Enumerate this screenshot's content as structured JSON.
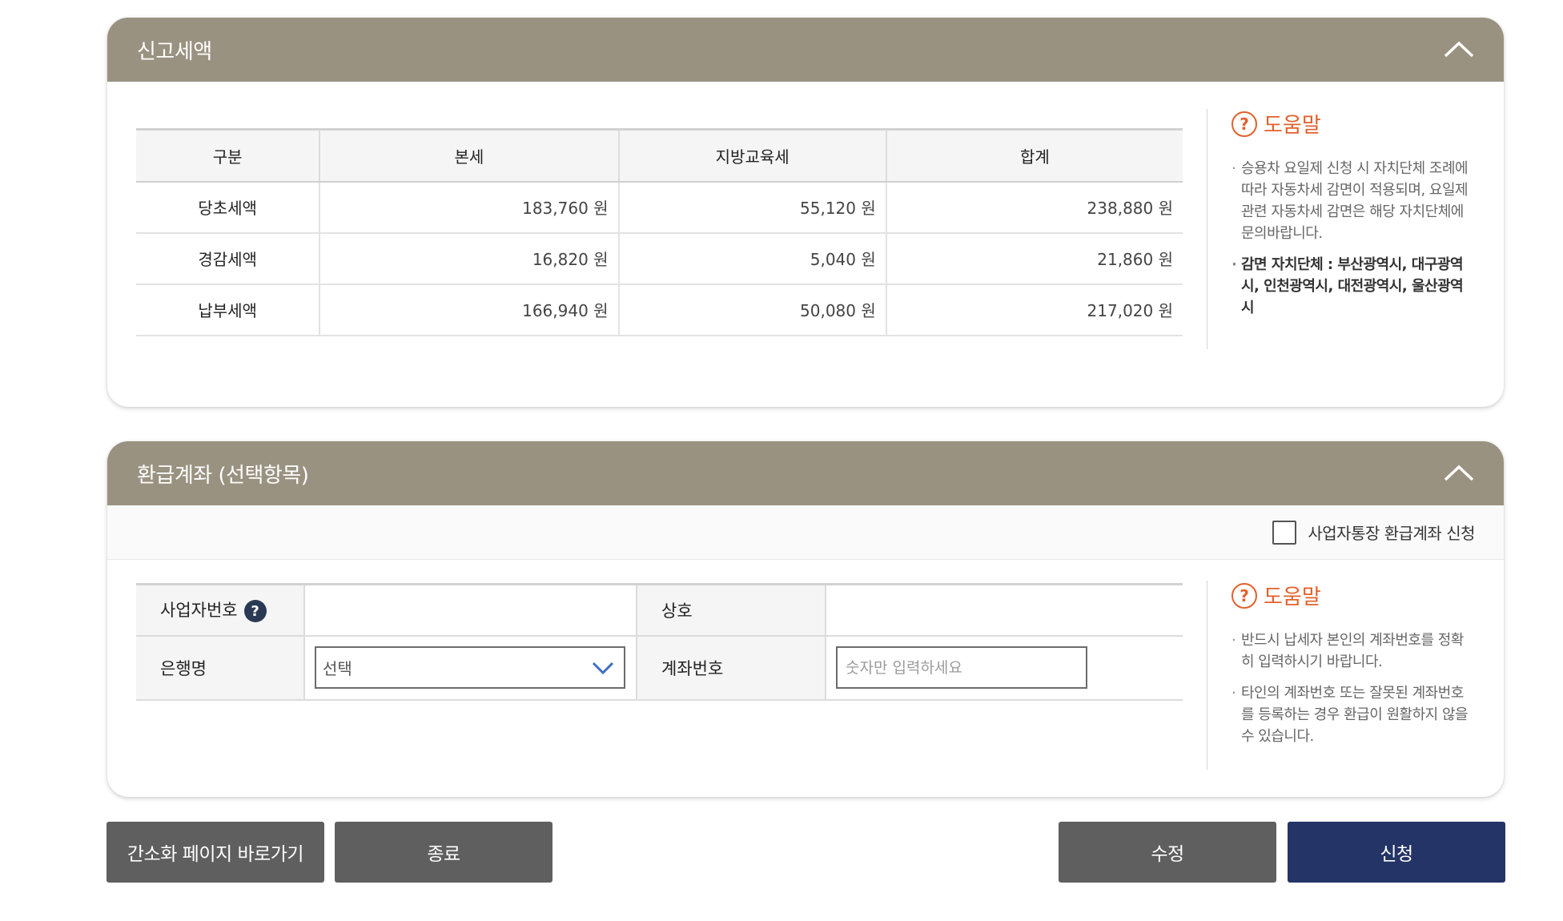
{
  "tax_section": {
    "title": "신고세액",
    "table": {
      "headers": [
        "구분",
        "본세",
        "지방교육세",
        "합계"
      ],
      "rows": [
        {
          "label": "당초세액",
          "base": "183,760 원",
          "edu": "55,120 원",
          "total": "238,880 원"
        },
        {
          "label": "경감세액",
          "base": "16,820 원",
          "edu": "5,040 원",
          "total": "21,860 원"
        },
        {
          "label": "납부세액",
          "base": "166,940 원",
          "edu": "50,080 원",
          "total": "217,020 원"
        }
      ]
    },
    "help": {
      "title": "도움말",
      "icon": "?",
      "items": [
        "승용차 요일제 신청 시 자치단체 조례에 따라 자동차세 감면이 적용되며, 요일제 관련 자동차세 감면은 해당 자치단체에 문의바랍니다.",
        "감면 자치단체 : 부산광역시, 대구광역시, 인천광역시, 대전광역시, 울산광역시"
      ]
    }
  },
  "refund_section": {
    "title": "환급계좌 (선택항목)",
    "business_checkbox_label": "사업자통장 환급계좌 신청",
    "fields": {
      "business_number_label": "사업자번호",
      "business_number_help": "?",
      "company_label": "상호",
      "bank_label": "은행명",
      "bank_selected": "선택",
      "account_label": "계좌번호",
      "account_placeholder": "숫자만 입력하세요"
    },
    "help": {
      "title": "도움말",
      "icon": "?",
      "items": [
        "반드시 납세자 본인의 계좌번호를 정확히 입력하시기 바랍니다.",
        "타인의 계좌번호 또는 잘못된 계좌번호를 등록하는 경우 환급이 원활하지 않을 수 있습니다."
      ]
    }
  },
  "buttons": {
    "simple_page": "간소화 페이지 바로가기",
    "exit": "종료",
    "edit": "수정",
    "apply": "신청"
  },
  "colors": {
    "header_bg": "#9a9281",
    "help_accent": "#e2602b",
    "primary_button": "#243466",
    "secondary_button": "#5f5f5f"
  }
}
